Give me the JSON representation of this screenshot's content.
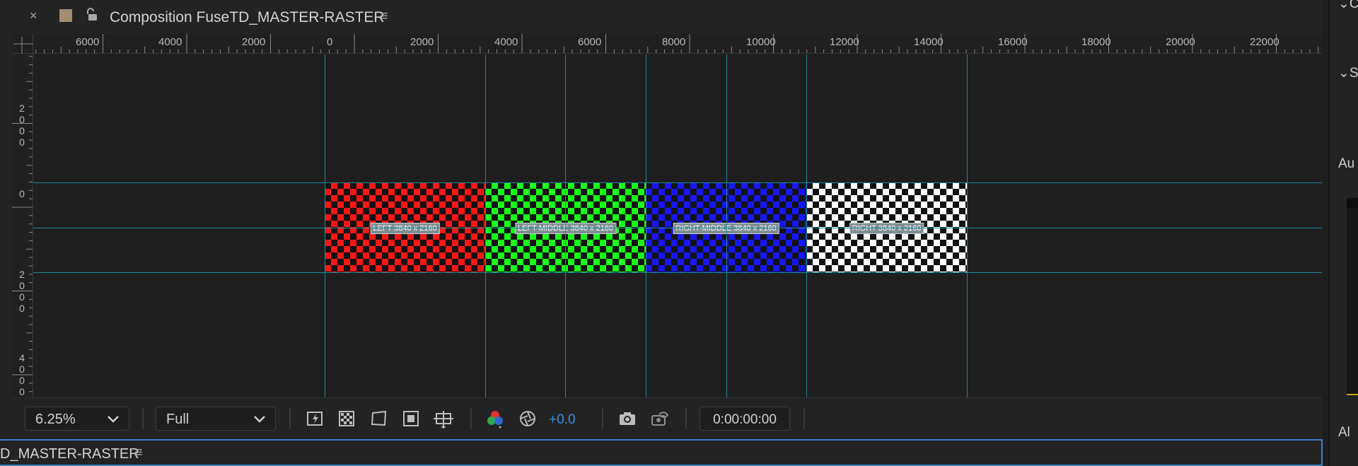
{
  "tab": {
    "title": "Composition FuseTD_MASTER-RASTER",
    "close_glyph": "×",
    "menu_glyph": "≡",
    "swatch_color": "#a38e72"
  },
  "ruler_top": {
    "labels": [
      "6000",
      "4000",
      "2000",
      "0",
      "2000",
      "4000",
      "6000",
      "8000",
      "10000",
      "12000",
      "14000",
      "16000",
      "18000",
      "20000",
      "22000"
    ]
  },
  "ruler_left": {
    "labels": [
      [
        "2",
        "0",
        "0",
        "0"
      ],
      [
        "0"
      ],
      [
        "0"
      ],
      [
        "2",
        "0",
        "0",
        "0"
      ],
      [
        "4",
        "0",
        "0",
        "0"
      ]
    ]
  },
  "screens": [
    {
      "name": "left",
      "label": "LEFT 3840 x 2160",
      "color": "red"
    },
    {
      "name": "left-middle",
      "label": "LEFT-MIDDLE 3840 x 2160",
      "color": "green"
    },
    {
      "name": "right-middle",
      "label": "RIGHT-MIDDLE 3840 x 2160",
      "color": "blue"
    },
    {
      "name": "right",
      "label": "RIGHT 3840 x 2160",
      "color": "white"
    }
  ],
  "toolbar": {
    "zoom": "6.25%",
    "resolution": "Full",
    "exposure": "+0.0",
    "timecode": "0:00:00:00"
  },
  "bottom_panel": {
    "title": "D_MASTER-RASTER",
    "menu_glyph": "≡"
  },
  "right_strip": {
    "items": [
      "⌄C",
      "⌄S",
      "Au",
      "Al"
    ]
  },
  "colors": {
    "guide": "#1c8a9a",
    "exposure_accent": "#3a8ee6",
    "focus_border": "#3f7fc9"
  }
}
